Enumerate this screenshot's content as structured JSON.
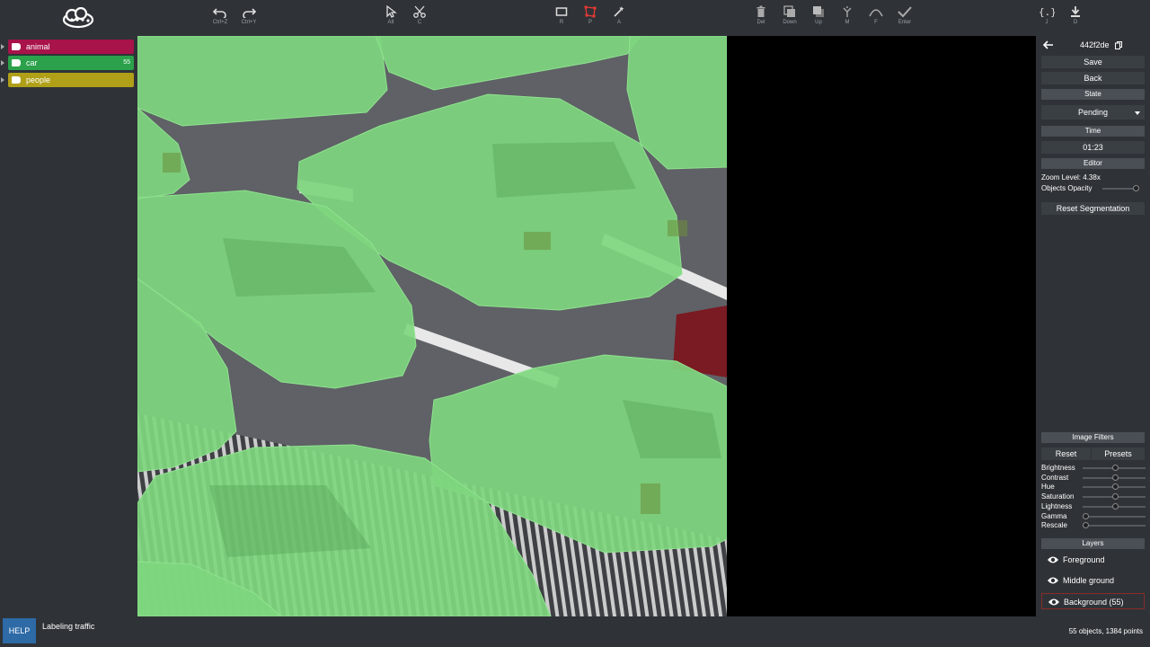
{
  "toolbar": {
    "undo": {
      "icon": "undo-icon",
      "key": "Ctrl+Z"
    },
    "redo": {
      "icon": "redo-icon",
      "key": "Ctrl+Y"
    },
    "select": {
      "icon": "cursor-icon",
      "key": "Alt"
    },
    "cut": {
      "icon": "scissors-icon",
      "key": "C"
    },
    "rect": {
      "icon": "rectangle-icon",
      "key": "R"
    },
    "polygon": {
      "icon": "polygon-icon",
      "key": "P"
    },
    "magic": {
      "icon": "magic-wand-icon",
      "key": "A"
    },
    "delete": {
      "icon": "trash-icon",
      "key": "Del"
    },
    "down": {
      "icon": "move-down-icon",
      "key": "Down"
    },
    "up": {
      "icon": "move-up-icon",
      "key": "Up"
    },
    "merge": {
      "icon": "merge-icon",
      "key": "M"
    },
    "fit": {
      "icon": "curve-icon",
      "key": "F"
    },
    "enter": {
      "icon": "check-icon",
      "key": "Enter"
    },
    "json": {
      "icon": "json-icon",
      "key": "J"
    },
    "download": {
      "icon": "download-icon",
      "key": "D"
    },
    "active_color": "#e53935"
  },
  "categories": [
    {
      "label": "animal",
      "count": "",
      "color": "#a8134a"
    },
    {
      "label": "car",
      "count": "55",
      "color": "#2aa14a"
    },
    {
      "label": "people",
      "count": "",
      "color": "#b0a018"
    }
  ],
  "right": {
    "image_id": "442f2de",
    "save": "Save",
    "back": "Back",
    "state_header": "State",
    "state_value": "Pending",
    "time_header": "Time",
    "time_value": "01:23",
    "editor_header": "Editor",
    "zoom_label": "Zoom Level: 4.38x",
    "opacity_label": "Objects Opacity",
    "reset_seg": "Reset Segmentation",
    "filters_header": "Image Filters",
    "reset": "Reset",
    "presets": "Presets",
    "filters": [
      {
        "label": "Brightness",
        "value": 0.5
      },
      {
        "label": "Contrast",
        "value": 0.5
      },
      {
        "label": "Hue",
        "value": 0.5
      },
      {
        "label": "Saturation",
        "value": 0.5
      },
      {
        "label": "Lightness",
        "value": 0.5
      },
      {
        "label": "Gamma",
        "value": 0.0
      },
      {
        "label": "Rescale",
        "value": 0.0
      }
    ],
    "layers_header": "Layers",
    "layers": [
      {
        "label": "Foreground"
      },
      {
        "label": "Middle ground"
      },
      {
        "label": "Background (55)"
      }
    ]
  },
  "status": {
    "help": "HELP",
    "task": "Labeling traffic",
    "summary": "55 objects, 1384 points"
  },
  "colors": {
    "mask": "#7ed67e",
    "panel": "#2f3337",
    "road": "#5f6166"
  }
}
